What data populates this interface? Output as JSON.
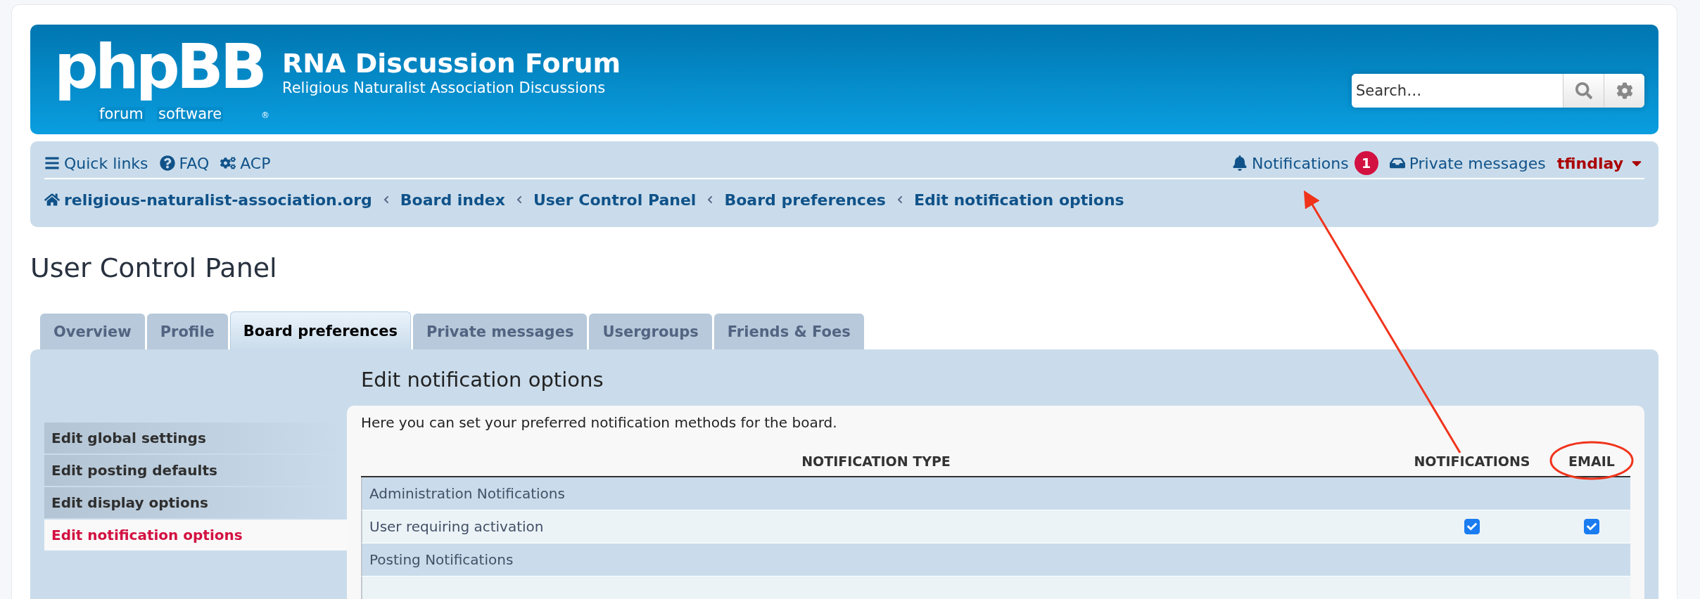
{
  "header": {
    "logo": {
      "word": "phpBB",
      "left": "forum",
      "right": "software",
      "mark": "®"
    },
    "title": "RNA Discussion Forum",
    "subtitle": "Religious Naturalist Association Discussions",
    "search": {
      "placeholder": "Search…"
    }
  },
  "navbar": {
    "left": [
      {
        "label": "Quick links"
      },
      {
        "label": "FAQ"
      },
      {
        "label": "ACP"
      }
    ],
    "notifications": {
      "label": "Notifications",
      "count": "1"
    },
    "messages": {
      "label": "Private messages"
    },
    "user": {
      "name": "tfindlay"
    }
  },
  "breadcrumbs": [
    "religious-naturalist-association.org",
    "Board index",
    "User Control Panel",
    "Board preferences",
    "Edit notification options"
  ],
  "page_title": "User Control Panel",
  "tabs": [
    {
      "label": "Overview",
      "selected": false
    },
    {
      "label": "Profile",
      "selected": false
    },
    {
      "label": "Board preferences",
      "selected": true
    },
    {
      "label": "Private messages",
      "selected": false
    },
    {
      "label": "Usergroups",
      "selected": false
    },
    {
      "label": "Friends & Foes",
      "selected": false
    }
  ],
  "sidebar": {
    "items": [
      {
        "label": "Edit global settings",
        "selected": false
      },
      {
        "label": "Edit posting defaults",
        "selected": false
      },
      {
        "label": "Edit display options",
        "selected": false
      },
      {
        "label": "Edit notification options",
        "selected": true
      }
    ]
  },
  "content": {
    "heading": "Edit notification options",
    "intro": "Here you can set your preferred notification methods for the board.",
    "table": {
      "columns": [
        "NOTIFICATION TYPE",
        "NOTIFICATIONS",
        "EMAIL"
      ],
      "rows": [
        {
          "kind": "section",
          "label": "Administration Notifications"
        },
        {
          "kind": "option",
          "label": "User requiring activation",
          "notifications": true,
          "email": true
        },
        {
          "kind": "section",
          "label": "Posting Notifications"
        }
      ]
    }
  }
}
